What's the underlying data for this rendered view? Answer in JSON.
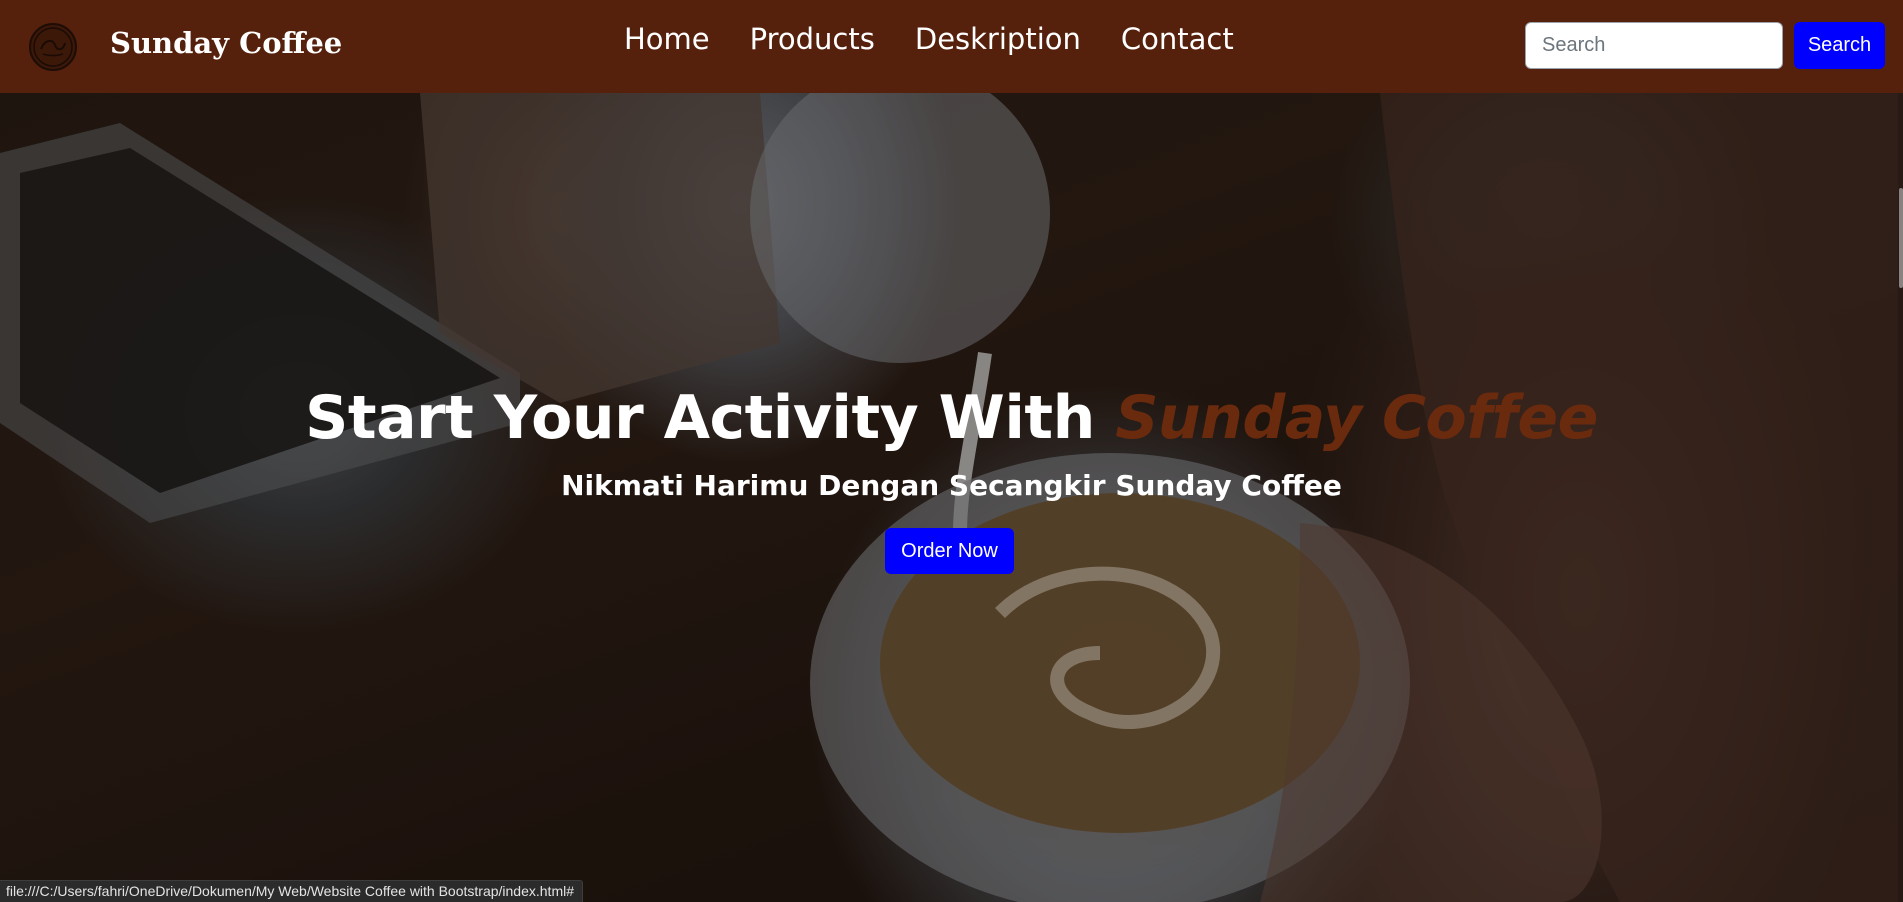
{
  "navbar": {
    "logo_icon": "coffee-logo-icon",
    "brand": "Sunday Coffee",
    "links": [
      "Home",
      "Products",
      "Deskription",
      "Contact"
    ],
    "search": {
      "placeholder": "Search",
      "value": "",
      "button_label": "Search"
    }
  },
  "hero": {
    "title_main": "Start Your Activity With",
    "title_accent": "Sunday Coffee",
    "subtitle": "Nikmati Harimu Dengan Secangkir Sunday Coffee",
    "order_button": "Order Now"
  },
  "status_bar": {
    "url": "file:///C:/Users/fahri/OneDrive/Dokumen/My Web/Website Coffee with Bootstrap/index.html#"
  },
  "colors": {
    "navbar_bg": "#55200c",
    "accent_text": "#6a2a0d",
    "button_blue": "#0000ff"
  }
}
